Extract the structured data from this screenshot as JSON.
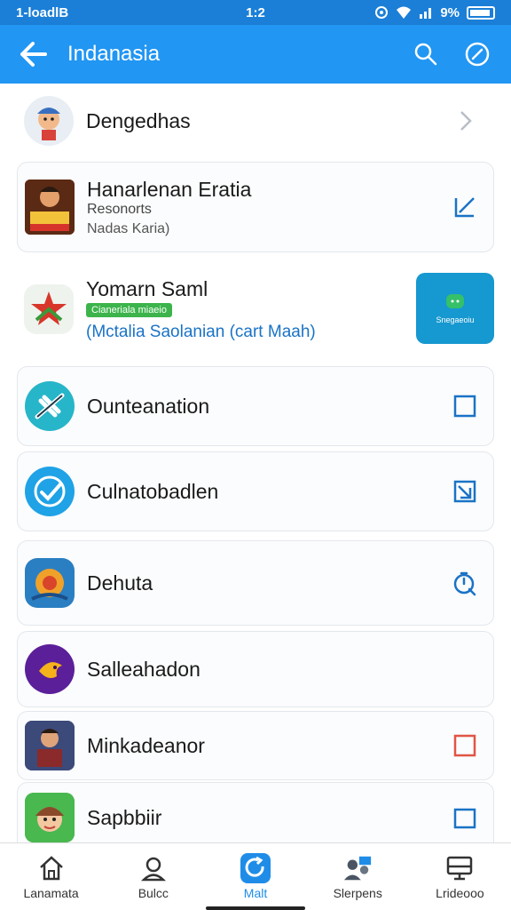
{
  "status_bar": {
    "left": "1-loadlB",
    "time": "1:2",
    "battery": "9%"
  },
  "app_bar": {
    "title": "Indanasia"
  },
  "items": [
    {
      "name": "Dengedhas",
      "icon": "avatar-man-icon",
      "trailing": "chevron-right-icon"
    },
    {
      "name": "Hanarlenan Eratia",
      "sub": "Resonorts",
      "sub2": "Nadas Karia)",
      "icon": "game-poster-icon",
      "trailing": "edit-icon"
    },
    {
      "name": "Yomarn Saml",
      "tag": "Cianeriala miaeio",
      "sub_blue": "(Mctalia Saolanian (cart Maah)",
      "icon": "star-icon",
      "tile_label": "Snegaeoiu"
    },
    {
      "name": "Ounteanation",
      "icon": "airplane-icon",
      "trailing": "checkbox-icon"
    },
    {
      "name": "Culnatobadlen",
      "icon": "check-circle-icon",
      "trailing": "checkbox-checked-icon"
    },
    {
      "name": "Dehuta",
      "icon": "game-icon",
      "trailing": "timer-icon"
    },
    {
      "name": "Salleahadon",
      "icon": "bird-icon"
    },
    {
      "name": "Minkadeanor",
      "icon": "warrior-icon",
      "trailing": "checkbox-red-icon"
    },
    {
      "name": "Sapbbiir",
      "icon": "character-icon",
      "trailing": "checkbox-icon"
    }
  ],
  "bottom_nav": [
    {
      "label": "Lanamata",
      "icon": "home-icon"
    },
    {
      "label": "Bulcc",
      "icon": "person-icon"
    },
    {
      "label": "Malt",
      "icon": "refresh-icon",
      "active": true
    },
    {
      "label": "Slerpens",
      "icon": "people-icon"
    },
    {
      "label": "Lrideooo",
      "icon": "tv-icon"
    }
  ],
  "colors": {
    "primary": "#2196f3",
    "status": "#1b7fd8",
    "accent": "#1f8de8",
    "tile": "#1698d0",
    "danger": "#e05545"
  }
}
